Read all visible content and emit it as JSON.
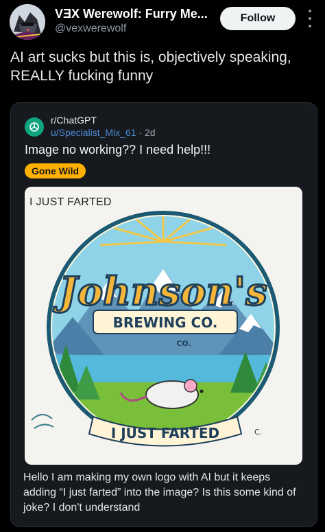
{
  "tweet": {
    "display_name": "VƎX Werewolf: Furry Me...",
    "handle": "@vexwerewolf",
    "follow_label": "Follow",
    "text": "AI art sucks but this is, objectively speaking, REALLY fucking funny"
  },
  "reddit": {
    "subreddit": "r/ChatGPT",
    "user": "u/Specialist_Mix_61",
    "separator": " · ",
    "time": "2d",
    "title": "Image no working?? I need help!!!",
    "flair": "Gone Wild",
    "body": "Hello I am making my own logo with AI but it keeps adding “I just farted” into the image? Is this some kind of joke? I don't understand"
  },
  "logo": {
    "top_text": "I JUST FARTED",
    "brand": "Johnson's",
    "subtitle": "BREWING CO.",
    "co": "CO.",
    "banner": "I JUST FARTED",
    "mark": "C."
  },
  "colors": {
    "flair": "#ffb000",
    "link": "#4e88d1",
    "chatgpt": "#10a37f"
  },
  "icons": {
    "more": "more-vertical-icon",
    "subreddit": "chatgpt-logo-icon"
  }
}
